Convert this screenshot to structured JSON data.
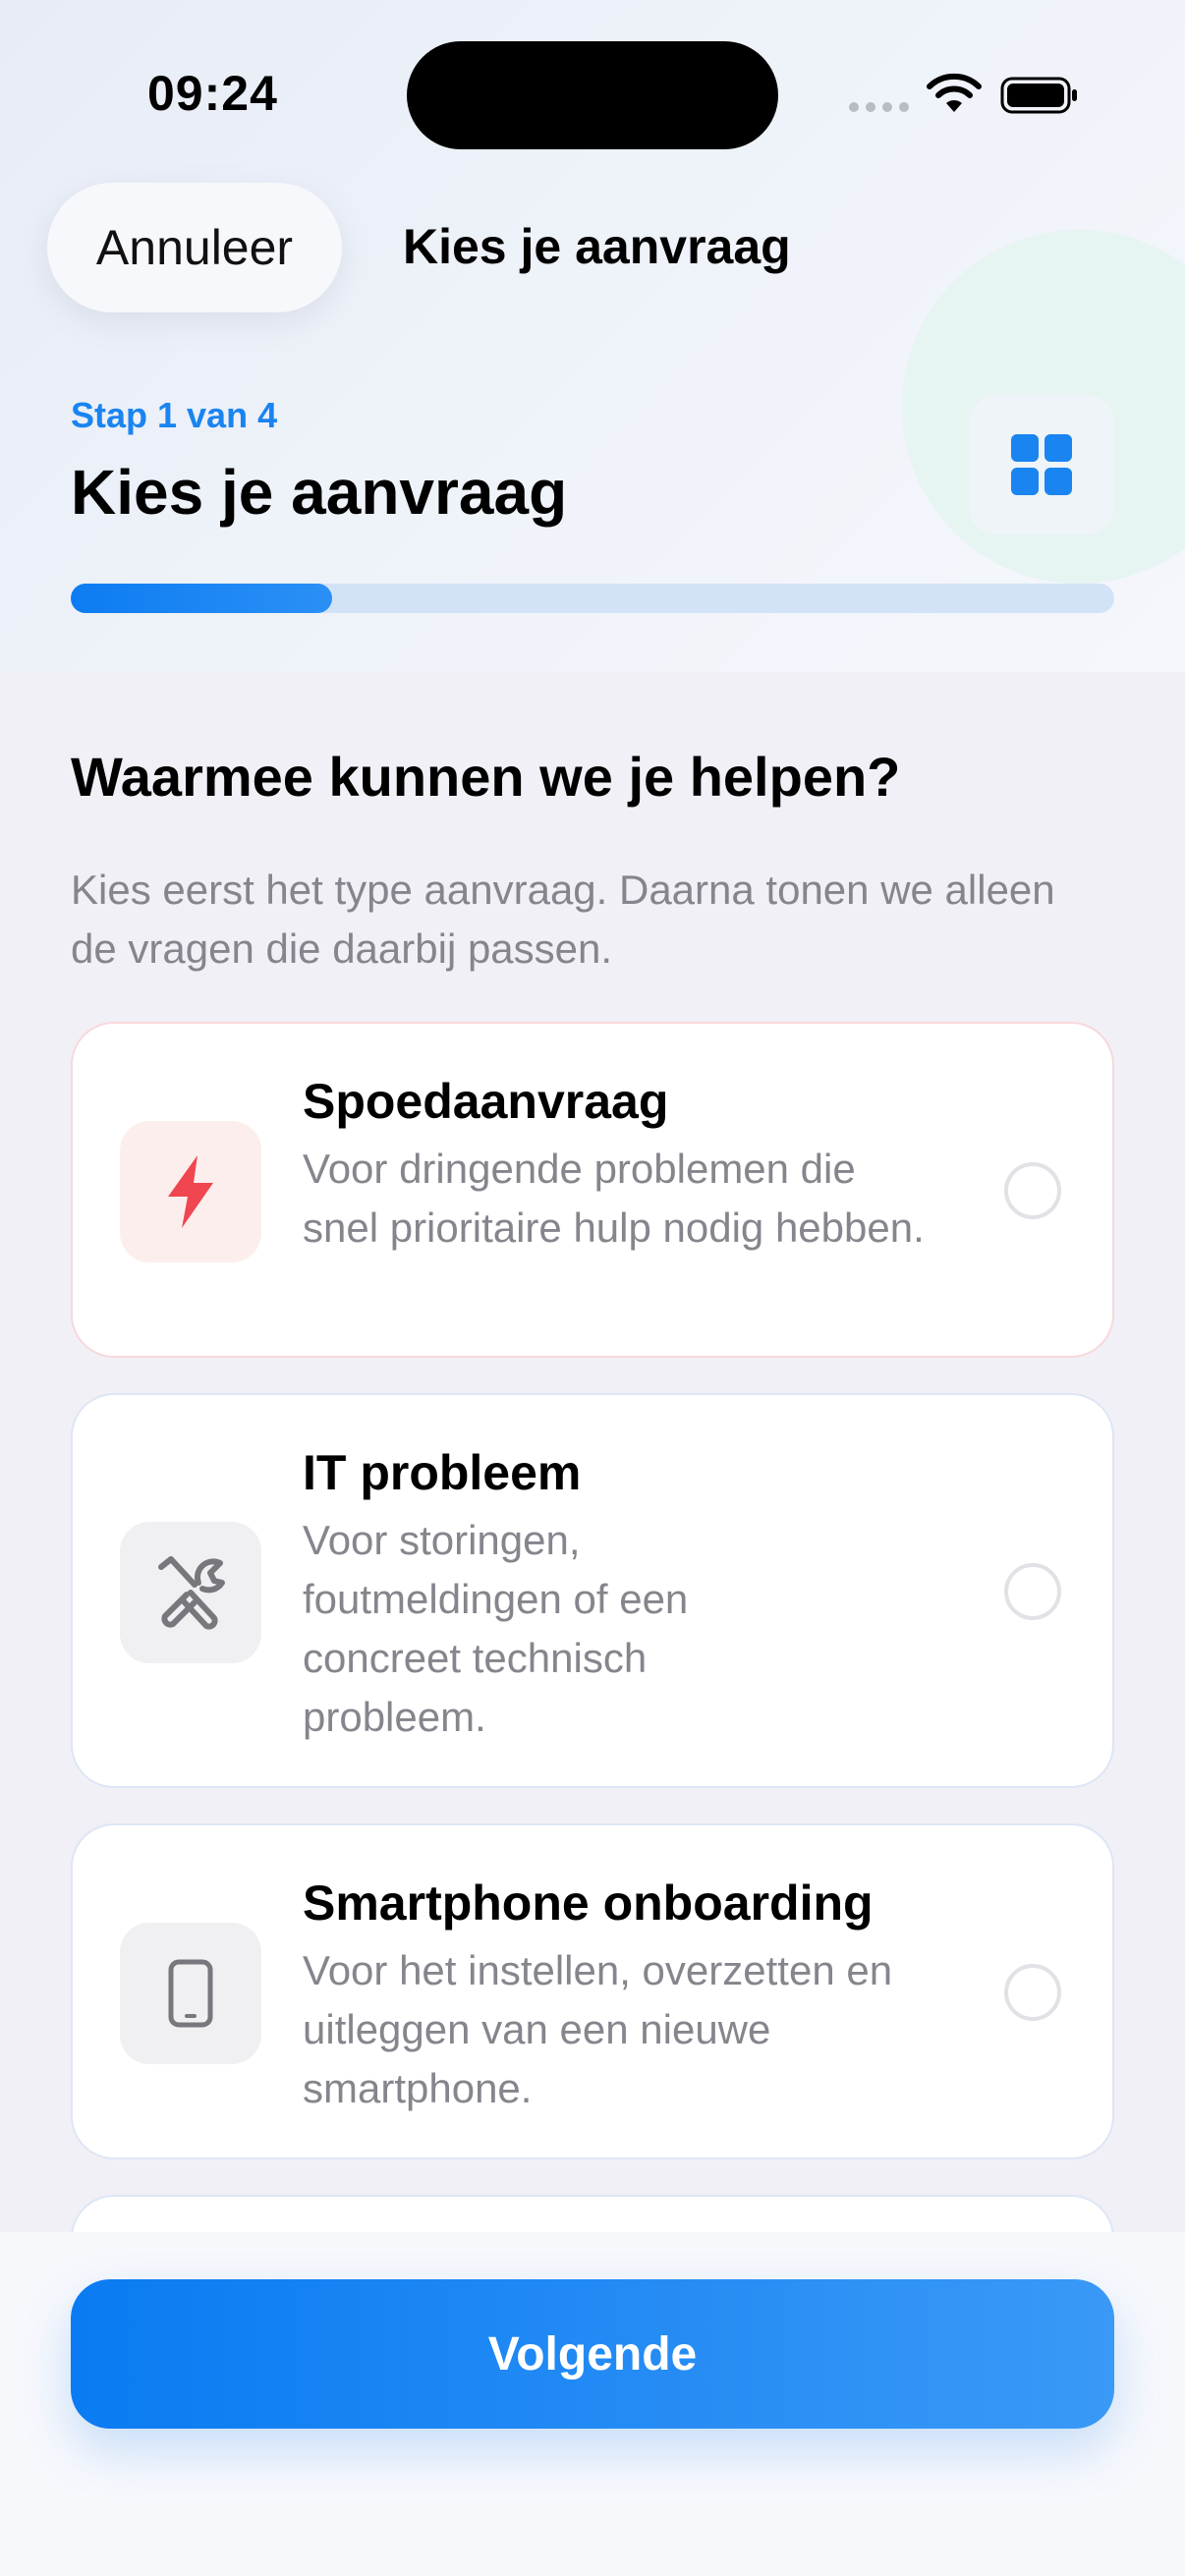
{
  "status_bar": {
    "time": "09:24"
  },
  "nav": {
    "cancel_label": "Annuleer",
    "title": "Kies je aanvraag"
  },
  "header": {
    "step_label": "Stap 1 van 4",
    "title": "Kies je aanvraag",
    "progress": 0.25,
    "icon": "grid-icon"
  },
  "main": {
    "question": "Waarmee kunnen we je helpen?",
    "intro": "Kies eerst het type aanvraag. Daarna tonen we alleen de vragen die daarbij passen.",
    "options": [
      {
        "title": "Spoedaanvraag",
        "description": "Voor dringende problemen die snel prioritaire hulp nodig hebben.",
        "icon": "lightning-icon",
        "selected": false
      },
      {
        "title": "IT probleem",
        "description": "Voor storingen, foutmeldingen of een concreet technisch probleem.",
        "icon": "tools-icon",
        "selected": false
      },
      {
        "title": "Smartphone onboarding",
        "description": "Voor het instellen, overzetten en uitleggen van een nieuwe smartphone.",
        "icon": "smartphone-icon",
        "selected": false
      }
    ]
  },
  "footer": {
    "next_label": "Volgende"
  },
  "colors": {
    "accent": "#1a84f0",
    "urgent": "#f0464f",
    "text_secondary": "#85858d"
  }
}
